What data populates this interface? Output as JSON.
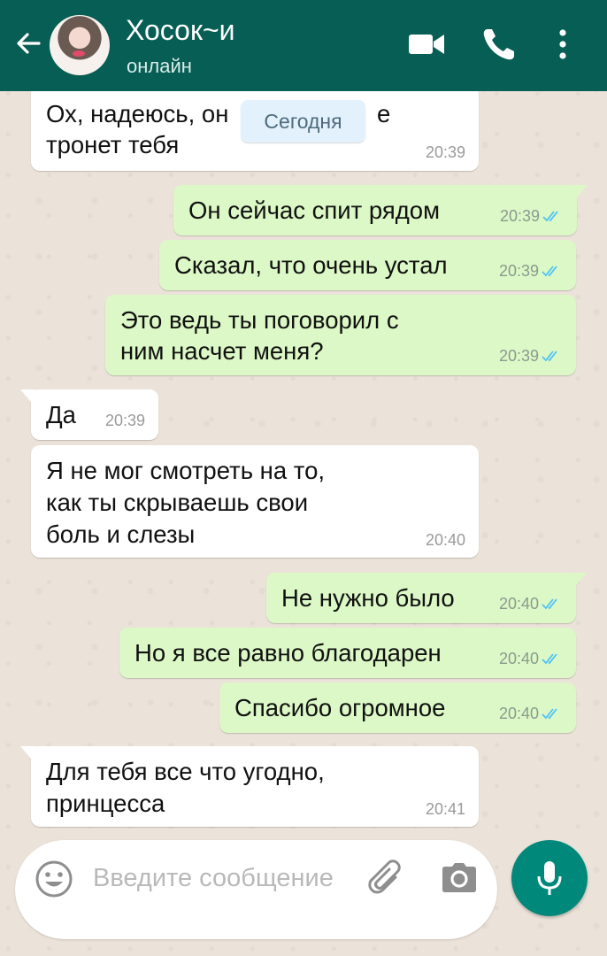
{
  "header": {
    "contact_name": "Хосок~и",
    "status": "онлайн",
    "icons": [
      "back-arrow-icon",
      "avatar",
      "video-call-icon",
      "phone-call-icon",
      "more-options-icon"
    ]
  },
  "date_divider": "Сегодня",
  "messages": [
    {
      "direction": "in",
      "lines": [
        "Ох, надеюсь, он ",
        "тронет тебя"
      ],
      "line1_tail": "е",
      "time": "20:39"
    },
    {
      "direction": "out",
      "lines": [
        "Он сейчас спит рядом"
      ],
      "time": "20:39",
      "read": true
    },
    {
      "direction": "out",
      "lines": [
        "Сказал, что очень устал"
      ],
      "time": "20:39",
      "read": true
    },
    {
      "direction": "out",
      "lines": [
        "Это ведь ты поговорил с",
        "ним насчет меня?"
      ],
      "time": "20:39",
      "read": true
    },
    {
      "direction": "in",
      "lines": [
        "Да"
      ],
      "time": "20:39"
    },
    {
      "direction": "in",
      "lines": [
        "Я не мог смотреть на то,",
        "как ты скрываешь свои",
        "боль и слезы"
      ],
      "time": "20:40"
    },
    {
      "direction": "out",
      "lines": [
        "Не нужно было"
      ],
      "time": "20:40",
      "read": true
    },
    {
      "direction": "out",
      "lines": [
        "Но я все равно благодарен"
      ],
      "time": "20:40",
      "read": true
    },
    {
      "direction": "out",
      "lines": [
        "Спасибо огромное"
      ],
      "time": "20:40",
      "read": true
    },
    {
      "direction": "in",
      "lines": [
        "Для тебя все что угодно,",
        "принцесса"
      ],
      "time": "20:41"
    }
  ],
  "composer": {
    "placeholder": "Введите сообщение",
    "value": "",
    "icons": [
      "emoji-icon",
      "attach-icon",
      "camera-icon",
      "mic-icon"
    ]
  },
  "colors": {
    "header": "#075e54",
    "outgoing_bubble": "#dcf8c6",
    "incoming_bubble": "#ffffff",
    "read_ticks": "#4fc3f7",
    "mic_button": "#00897b",
    "wallpaper": "#ebe3d9"
  }
}
